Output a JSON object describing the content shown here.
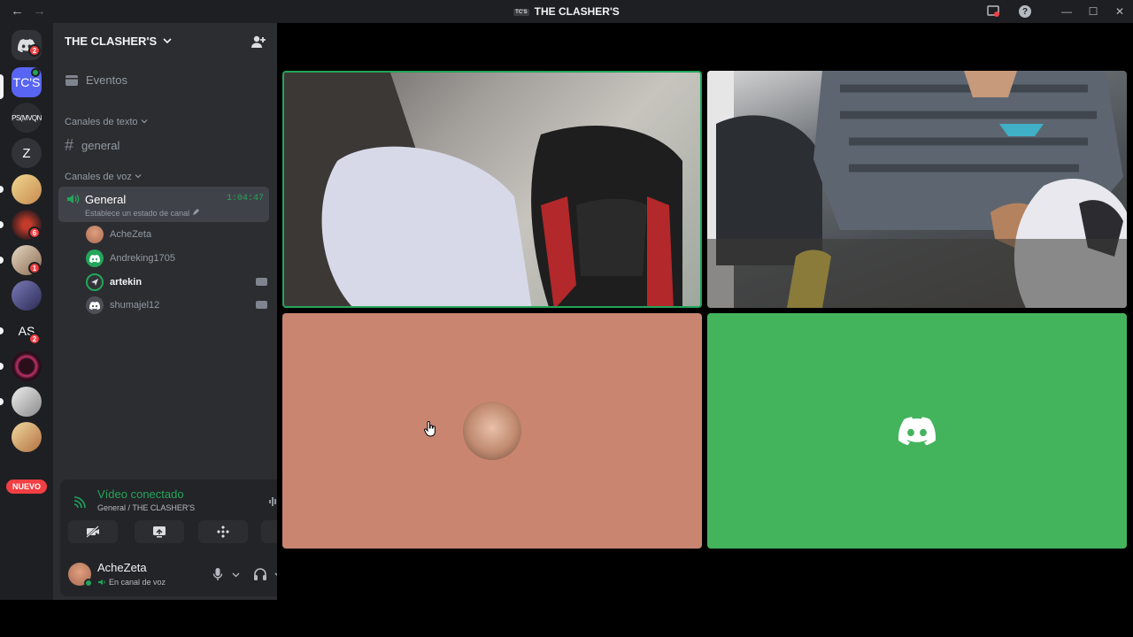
{
  "window": {
    "title": "THE CLASHER'S",
    "server_tag": "TC'S",
    "nav_back": "←",
    "nav_forward": "→",
    "help": "?",
    "minimize": "—",
    "maximize": "☐",
    "close": "✕"
  },
  "guilds": [
    {
      "label": "",
      "badge": "2",
      "kind": "home"
    },
    {
      "label": "TC'S",
      "badge": "",
      "kind": "text",
      "color": "#5865f2"
    },
    {
      "label": "PS(MVQN",
      "badge": "",
      "kind": "text",
      "color": "#2b2d31"
    },
    {
      "label": "Z",
      "badge": "",
      "kind": "text",
      "color": "#313338"
    },
    {
      "label": "",
      "badge": "",
      "kind": "img",
      "color": "#d8b36e"
    },
    {
      "label": "",
      "badge": "6",
      "kind": "img",
      "color": "#3a1f1f"
    },
    {
      "label": "",
      "badge": "1",
      "kind": "img",
      "color": "#b49a80"
    },
    {
      "label": "",
      "badge": "",
      "kind": "img",
      "color": "#3b3a66"
    },
    {
      "label": "AS",
      "badge": "2",
      "kind": "text",
      "color": "#1e1f22"
    },
    {
      "label": "",
      "badge": "",
      "kind": "img",
      "color": "#7a1830"
    },
    {
      "label": "",
      "badge": "",
      "kind": "img",
      "color": "#c9c9c9"
    },
    {
      "label": "",
      "badge": "",
      "kind": "img",
      "color": "#d0a060"
    }
  ],
  "guild_nuevo": "NUEVO",
  "sidebar": {
    "server_name": "THE CLASHER'S",
    "events": "Eventos",
    "text_category": "Canales de texto",
    "text_channel": "general",
    "voice_category": "Canales de voz",
    "voice_channel": {
      "name": "General",
      "time": "1:04:47",
      "status": "Establece un estado de canal"
    },
    "voice_users": [
      {
        "name": "AcheZeta",
        "bold": false,
        "camera": false,
        "avatar": "photo"
      },
      {
        "name": "Andreking1705",
        "bold": false,
        "camera": false,
        "avatar": "discord-green"
      },
      {
        "name": "artekin",
        "bold": true,
        "camera": true,
        "avatar": "dark"
      },
      {
        "name": "shumajel12",
        "bold": false,
        "camera": true,
        "avatar": "discord-grey"
      }
    ]
  },
  "voice_panel": {
    "title": "Vídeo conectado",
    "subtitle": "General / THE CLASHER'S"
  },
  "user_panel": {
    "name": "AcheZeta",
    "status": "En canal de voz"
  },
  "colors": {
    "accent_green": "#23a55a",
    "discord_blurple": "#5865f2",
    "tile_salmon": "#c98570",
    "tile_green": "#43b45c",
    "danger": "#f23f43"
  }
}
